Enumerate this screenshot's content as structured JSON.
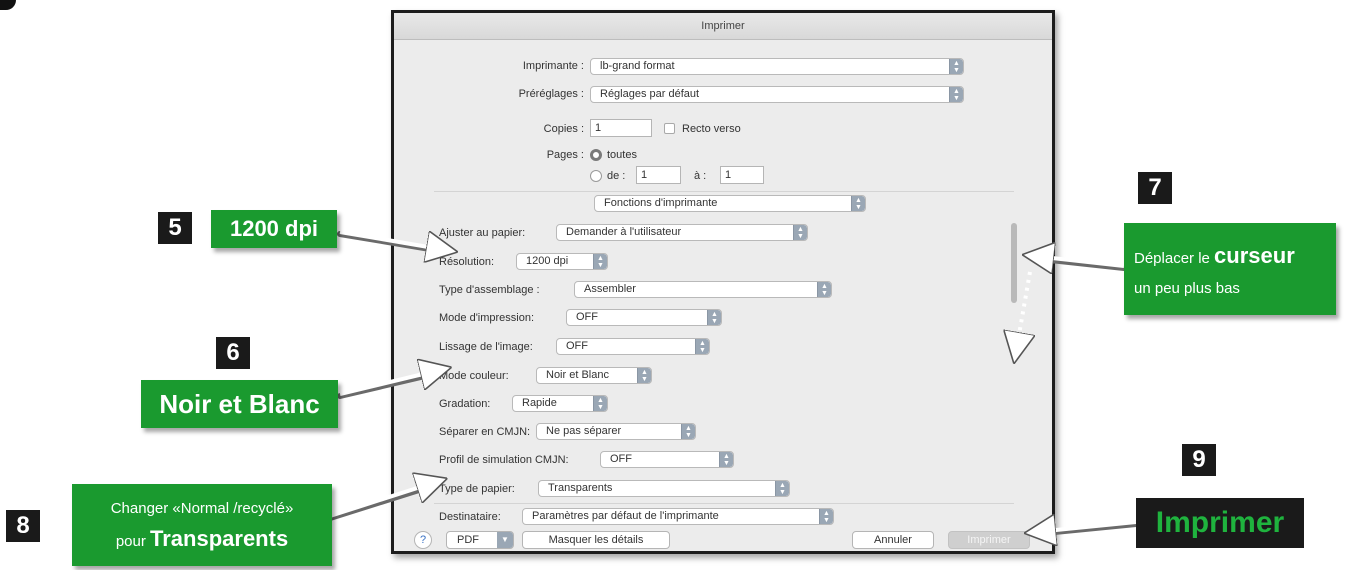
{
  "dialog": {
    "title": "Imprimer",
    "printer_label": "Imprimante :",
    "printer_value": "lb-grand format",
    "presets_label": "Préréglages :",
    "presets_value": "Réglages par défaut",
    "copies_label": "Copies :",
    "copies_value": "1",
    "duplex_label": "Recto verso",
    "pages_label": "Pages :",
    "pages_all_label": "toutes",
    "pages_from_label": "de :",
    "pages_from_value": "1",
    "pages_to_label": "à :",
    "pages_to_value": "1",
    "section_value": "Fonctions d'imprimante",
    "settings": {
      "fit_label": "Ajuster au papier:",
      "fit_value": "Demander à l'utilisateur",
      "resolution_label": "Résolution:",
      "resolution_value": "1200 dpi",
      "collate_label": "Type d'assemblage :",
      "collate_value": "Assembler",
      "print_mode_label": "Mode d'impression:",
      "print_mode_value": "OFF",
      "smoothing_label": "Lissage de l'image:",
      "smoothing_value": "OFF",
      "color_mode_label": "Mode couleur:",
      "color_mode_value": "Noir et Blanc",
      "gradation_label": "Gradation:",
      "gradation_value": "Rapide",
      "cmyk_sep_label": "Séparer en CMJN:",
      "cmyk_sep_value": "Ne pas séparer",
      "cmyk_profile_label": "Profil de simulation CMJN:",
      "cmyk_profile_value": "OFF",
      "paper_type_label": "Type de papier:",
      "paper_type_value": "Transparents",
      "destination_label": "Destinataire:",
      "destination_value": "Paramètres par défaut de l'imprimante"
    },
    "footer": {
      "help_label": "?",
      "pdf_label": "PDF",
      "details_label": "Masquer les détails",
      "cancel_label": "Annuler",
      "print_label": "Imprimer"
    }
  },
  "callouts": {
    "c5": {
      "number": "5",
      "text": "1200 dpi"
    },
    "c6": {
      "number": "6",
      "text": "Noir et Blanc"
    },
    "c7": {
      "number": "7",
      "text_pre": "Déplacer le",
      "text_bold": "curseur",
      "text_post": "un peu plus bas"
    },
    "c8": {
      "number": "8",
      "text_pre": "Changer «Normal /recyclé»",
      "text_mid": "pour",
      "text_bold": "Transparents"
    },
    "c9": {
      "number": "9",
      "text": "Imprimer"
    }
  },
  "colors": {
    "callout_green": "#1a9a2f",
    "number_box": "#1a1a1a",
    "arrow": "#ffffff"
  }
}
